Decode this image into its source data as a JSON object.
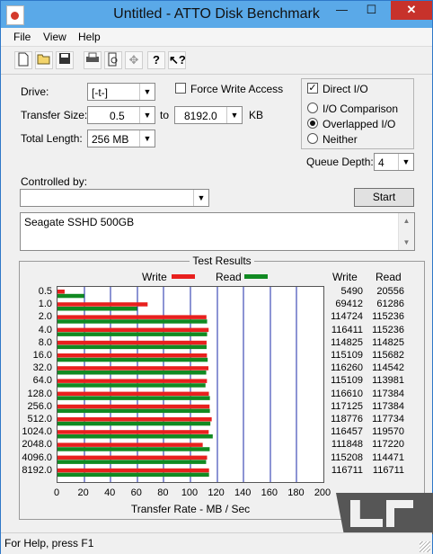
{
  "window": {
    "title": "Untitled - ATTO Disk Benchmark",
    "minimize": "—",
    "maximize": "☐",
    "close": "✕"
  },
  "menu": [
    "File",
    "View",
    "Help"
  ],
  "toolbar": [
    "new-icon",
    "open-icon",
    "save-icon",
    "print-icon",
    "print-preview-icon",
    "move-icon",
    "help-icon",
    "context-help-icon"
  ],
  "drive": {
    "label": "Drive:",
    "value": "[-t-]"
  },
  "force_write": {
    "label": "Force Write Access",
    "checked": false
  },
  "direct_io": {
    "label": "Direct I/O",
    "checked": true
  },
  "transfer_size": {
    "label": "Transfer Size:",
    "from": "0.5",
    "to_label": "to",
    "to": "8192.0",
    "unit": "KB"
  },
  "total_length": {
    "label": "Total Length:",
    "value": "256 MB"
  },
  "io_mode": {
    "options": [
      "I/O Comparison",
      "Overlapped I/O",
      "Neither"
    ],
    "selected": "Overlapped I/O"
  },
  "queue_depth": {
    "label": "Queue Depth:",
    "value": "4"
  },
  "controlled_by": {
    "label": "Controlled by:",
    "value": ""
  },
  "start_button": "Start",
  "description": "Seagate SSHD 500GB",
  "status": "For Help, press F1",
  "chart_data": {
    "type": "bar",
    "orientation": "horizontal",
    "title": "Test Results",
    "xlabel": "Transfer Rate - MB / Sec",
    "xlim": [
      0,
      200
    ],
    "xticks": [
      "0",
      "20",
      "40",
      "60",
      "80",
      "100",
      "120",
      "140",
      "160",
      "180",
      "200"
    ],
    "grid": true,
    "legend_position": "top",
    "column_headers": [
      "Write",
      "Read"
    ],
    "categories": [
      "0.5",
      "1.0",
      "2.0",
      "4.0",
      "8.0",
      "16.0",
      "32.0",
      "64.0",
      "128.0",
      "256.0",
      "512.0",
      "1024.0",
      "2048.0",
      "4096.0",
      "8192.0"
    ],
    "series": [
      {
        "name": "Write",
        "color": "#e8201e",
        "values": [
          5490,
          69412,
          114724,
          116411,
          114825,
          115109,
          116260,
          115109,
          116610,
          117125,
          118776,
          116457,
          111848,
          115208,
          116711
        ]
      },
      {
        "name": "Read",
        "color": "#118a22",
        "values": [
          20556,
          61286,
          115236,
          115236,
          114825,
          115682,
          114542,
          113981,
          117384,
          117384,
          117734,
          119570,
          117220,
          114471,
          116711
        ]
      }
    ],
    "value_unit": "KB/s"
  }
}
